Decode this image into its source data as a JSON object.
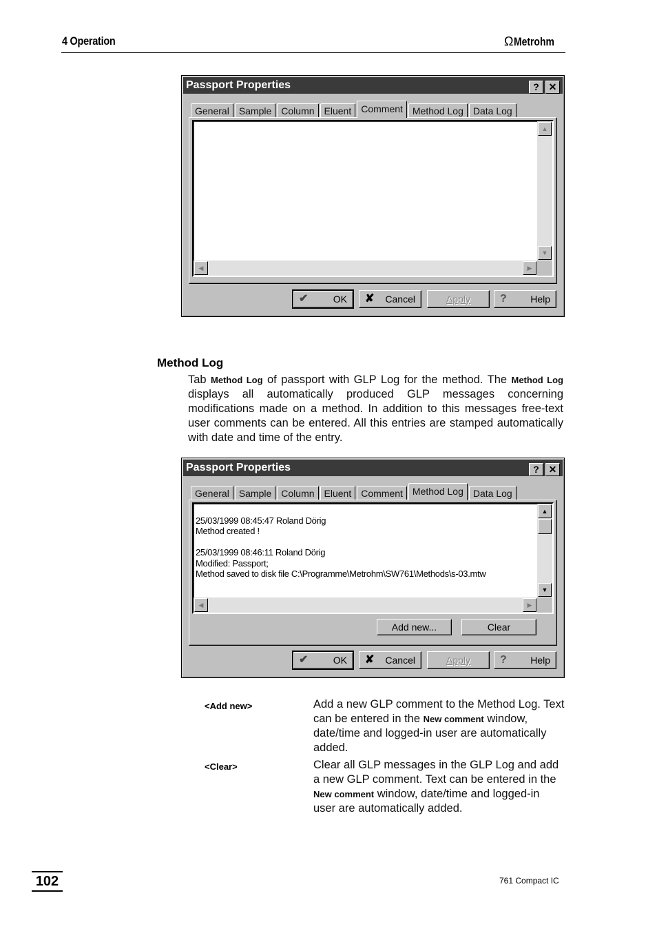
{
  "header": {
    "section": "4  Operation",
    "brand": "Metrohm",
    "brand_icon": "omega-logo-icon"
  },
  "dialog1": {
    "title": "Passport Properties",
    "help_btn": "?",
    "close_btn": "✕",
    "tabs": [
      {
        "label": "General",
        "active": false
      },
      {
        "label": "Sample",
        "active": false
      },
      {
        "label": "Column",
        "active": false
      },
      {
        "label": "Eluent",
        "active": false
      },
      {
        "label": "Comment",
        "active": true
      },
      {
        "label": "Method Log",
        "active": false
      },
      {
        "label": "Data Log",
        "active": false
      }
    ],
    "text_content": "",
    "buttons": {
      "ok": "OK",
      "cancel": "Cancel",
      "apply": "Apply",
      "help": "Help"
    }
  },
  "section": {
    "title": "Method Log",
    "para_parts": [
      "Tab ",
      "Method Log",
      " of passport with GLP Log for the method. The ",
      "Method Log",
      " displays all automatically produced GLP messages concerning modifications made on a method. In addition to this messages free-text user comments can be entered. All this entries are stamped automatically with date and time of the entry."
    ]
  },
  "dialog2": {
    "title": "Passport Properties",
    "help_btn": "?",
    "close_btn": "✕",
    "tabs": [
      {
        "label": "General",
        "active": false
      },
      {
        "label": "Sample",
        "active": false
      },
      {
        "label": "Column",
        "active": false
      },
      {
        "label": "Eluent",
        "active": false
      },
      {
        "label": "Comment",
        "active": false
      },
      {
        "label": "Method Log",
        "active": true
      },
      {
        "label": "Data Log",
        "active": false
      }
    ],
    "log_lines": [
      "",
      "25/03/1999 08:45:47 Roland Dörig",
      "Method created !",
      "",
      "25/03/1999 08:46:11 Roland Dörig",
      "Modified: Passport;",
      "Method saved to disk file C:\\Programme\\Metrohm\\SW761\\Methods\\s-03.mtw"
    ],
    "add_new": "Add new...",
    "clear": "Clear",
    "buttons": {
      "ok": "OK",
      "cancel": "Cancel",
      "apply": "Apply",
      "help": "Help"
    }
  },
  "definitions": [
    {
      "term": "<Add new>",
      "desc_parts": [
        "Add a new GLP comment to the Method Log. Text can be entered in the ",
        "New comment",
        " window, date/time and logged-in user are automatically added."
      ]
    },
    {
      "term": "<Clear>",
      "desc_parts": [
        "Clear all GLP messages in the GLP Log and add a new GLP comment. Text can be entered in the ",
        "New comment",
        " window, date/time and logged-in user are automatically added."
      ]
    }
  ],
  "footer": {
    "page_number": "102",
    "product": "761 Compact IC"
  }
}
